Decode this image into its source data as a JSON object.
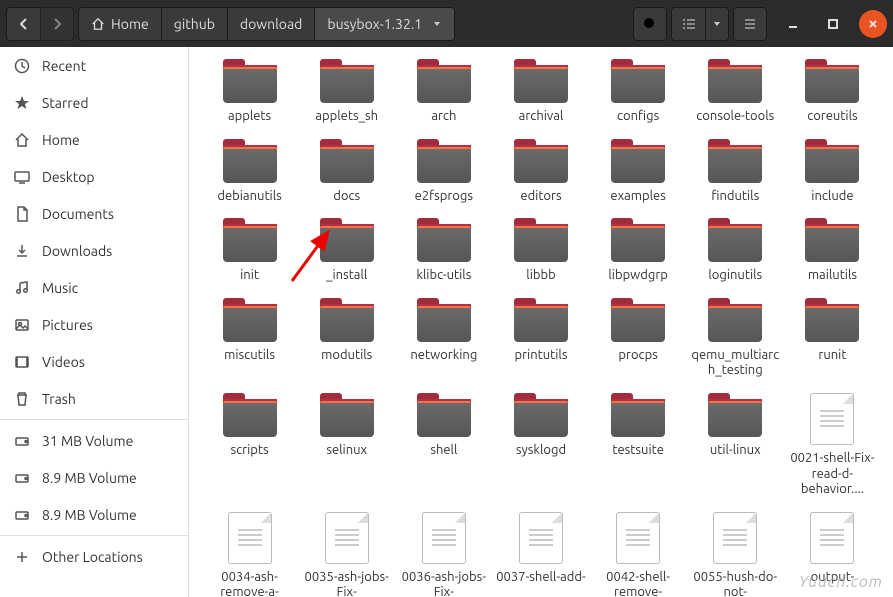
{
  "breadcrumb": {
    "home": "Home",
    "segments": [
      "github",
      "download"
    ],
    "current": "busybox-1.32.1"
  },
  "sidebar": {
    "items": [
      {
        "icon": "clock",
        "label": "Recent"
      },
      {
        "icon": "star",
        "label": "Starred"
      },
      {
        "icon": "home",
        "label": "Home"
      },
      {
        "icon": "desktop",
        "label": "Desktop"
      },
      {
        "icon": "doc",
        "label": "Documents"
      },
      {
        "icon": "download",
        "label": "Downloads"
      },
      {
        "icon": "music",
        "label": "Music"
      },
      {
        "icon": "picture",
        "label": "Pictures"
      },
      {
        "icon": "video",
        "label": "Videos"
      },
      {
        "icon": "trash",
        "label": "Trash"
      }
    ],
    "volumes": [
      {
        "label": "31 MB Volume"
      },
      {
        "label": "8.9 MB Volume"
      },
      {
        "label": "8.9 MB Volume"
      }
    ],
    "other": "Other Locations"
  },
  "folders": [
    "applets",
    "applets_sh",
    "arch",
    "archival",
    "configs",
    "console-tools",
    "coreutils",
    "debianutils",
    "docs",
    "e2fsprogs",
    "editors",
    "examples",
    "findutils",
    "include",
    "init",
    "_install",
    "klibc-utils",
    "libbb",
    "libpwdgrp",
    "loginutils",
    "mailutils",
    "miscutils",
    "modutils",
    "networking",
    "printutils",
    "procps",
    "qemu_multiarch_testing",
    "runit",
    "scripts",
    "selinux",
    "shell",
    "sysklogd",
    "testsuite",
    "util-linux"
  ],
  "files": [
    "0021-shell-Fix-read-d-behavior....",
    "0034-ash-remove-a-",
    "0035-ash-jobs-Fix-",
    "0036-ash-jobs-Fix-",
    "0037-shell-add-",
    "0042-shell-remove-",
    "0055-hush-do-not-",
    "output-"
  ],
  "watermark": "Yuucn.com"
}
